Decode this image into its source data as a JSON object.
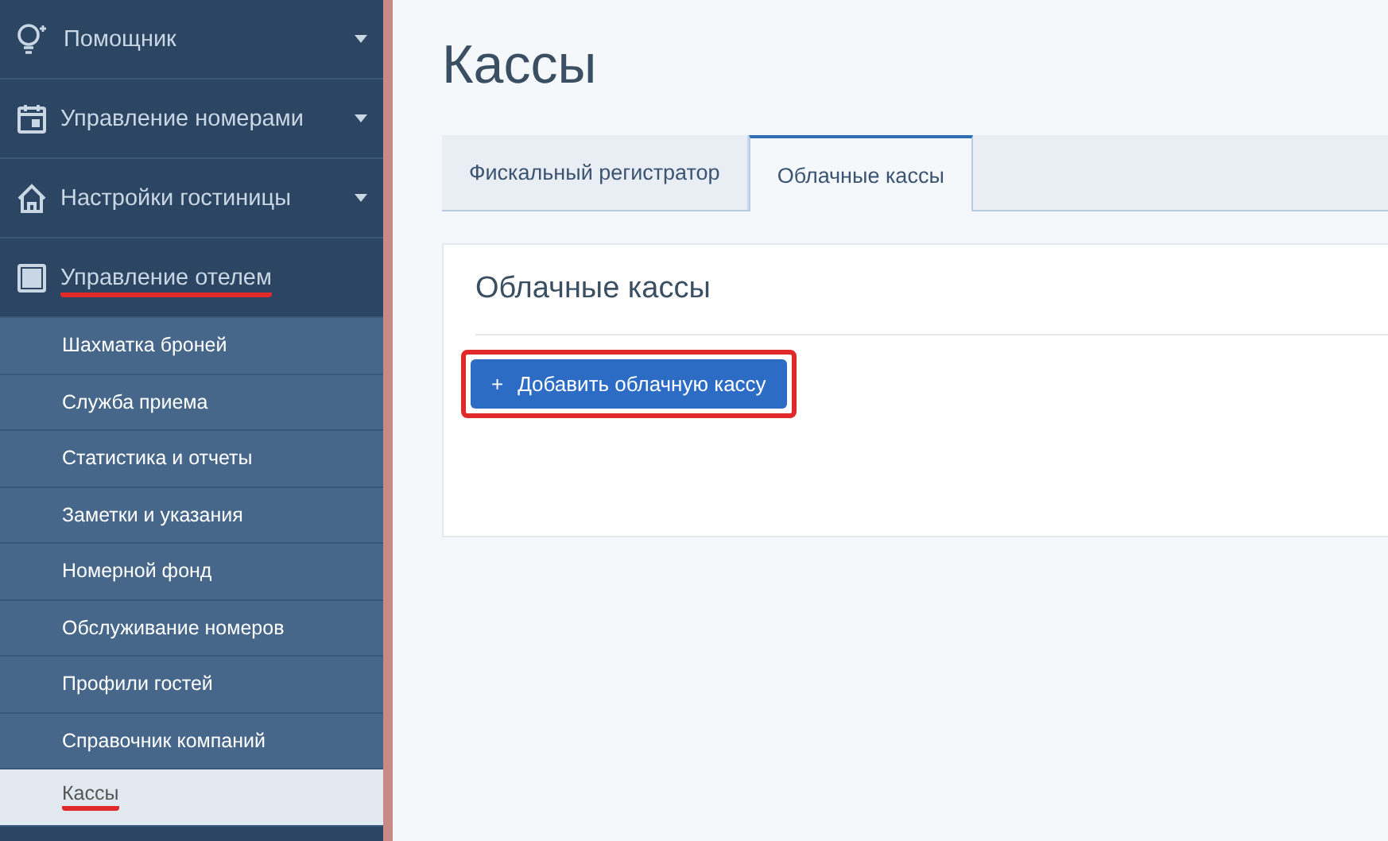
{
  "sidebar": {
    "items": [
      {
        "label": "Помощник",
        "caret": true,
        "highlighted": false
      },
      {
        "label": "Управление номерами",
        "caret": true,
        "highlighted": false
      },
      {
        "label": "Настройки гостиницы",
        "caret": true,
        "highlighted": false
      },
      {
        "label": "Управление отелем",
        "caret": false,
        "highlighted": true,
        "children": [
          {
            "label": "Шахматка броней",
            "selected": false,
            "highlighted": false
          },
          {
            "label": "Служба приема",
            "selected": false,
            "highlighted": false
          },
          {
            "label": "Статистика и отчеты",
            "selected": false,
            "highlighted": false
          },
          {
            "label": "Заметки и указания",
            "selected": false,
            "highlighted": false
          },
          {
            "label": "Номерной фонд",
            "selected": false,
            "highlighted": false
          },
          {
            "label": "Обслуживание номеров",
            "selected": false,
            "highlighted": false
          },
          {
            "label": "Профили гостей",
            "selected": false,
            "highlighted": false
          },
          {
            "label": "Справочник компаний",
            "selected": false,
            "highlighted": false
          },
          {
            "label": "Кассы",
            "selected": true,
            "highlighted": true
          }
        ]
      }
    ]
  },
  "page": {
    "title": "Кассы",
    "tabs": [
      {
        "label": "Фискальный регистратор",
        "selected": false
      },
      {
        "label": "Облачные кассы",
        "selected": true
      }
    ],
    "card": {
      "title": "Облачные кассы",
      "button": {
        "icon": "+",
        "label": "Добавить облачную кассу",
        "highlighted": true
      }
    }
  }
}
